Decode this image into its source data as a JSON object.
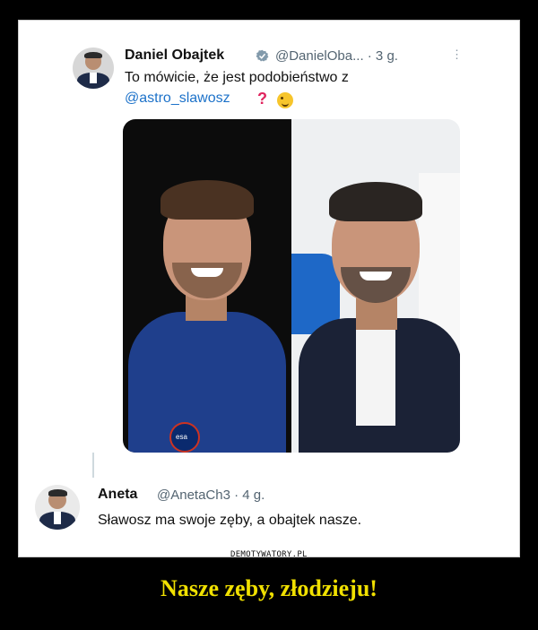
{
  "tweet1": {
    "author_name": "Daniel Obajtek",
    "handle_time": "@DanielOba... · 3 g.",
    "text": "To mówicie, że jest podobieństwo z",
    "mention": "@astro_slawosz",
    "question_mark": "?",
    "emoji": "winking-face"
  },
  "tweet2": {
    "author_name": "Aneta",
    "handle_time": "@AnetaCh3 · 4 g.",
    "text": "Sławosz ma swoje zęby,  a obajtek nasze."
  },
  "watermark": "DEMOTYWATORY.PL",
  "caption": "Nasze zęby, złodzieju!",
  "colors": {
    "background": "#000000",
    "caption": "#f0e000",
    "link": "#1d72c9",
    "verified": "#829aab"
  },
  "patch_text": "esa"
}
